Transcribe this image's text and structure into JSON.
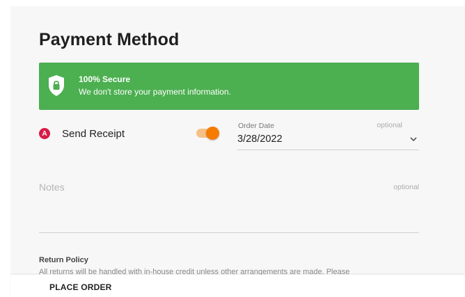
{
  "page": {
    "title": "Payment Method"
  },
  "secure_banner": {
    "title": "100% Secure",
    "description": "We don't store your payment information.",
    "icon": "shield-lock-icon",
    "color": "#4caf50"
  },
  "send_receipt": {
    "badge_letter": "A",
    "badge_color": "#d81b46",
    "label": "Send Receipt",
    "enabled": true,
    "accent_color": "#f57c00"
  },
  "order_date": {
    "label": "Order Date",
    "optional_text": "optional",
    "value": "3/28/2022",
    "icon": "chevron-down-icon"
  },
  "notes": {
    "placeholder": "Notes",
    "optional_text": "optional",
    "value": ""
  },
  "return_policy": {
    "title": "Return Policy",
    "text": "All returns will be handled with in-house credit unless other arrangements are made. Please"
  },
  "footer": {
    "place_order_label": "PLACE ORDER"
  }
}
